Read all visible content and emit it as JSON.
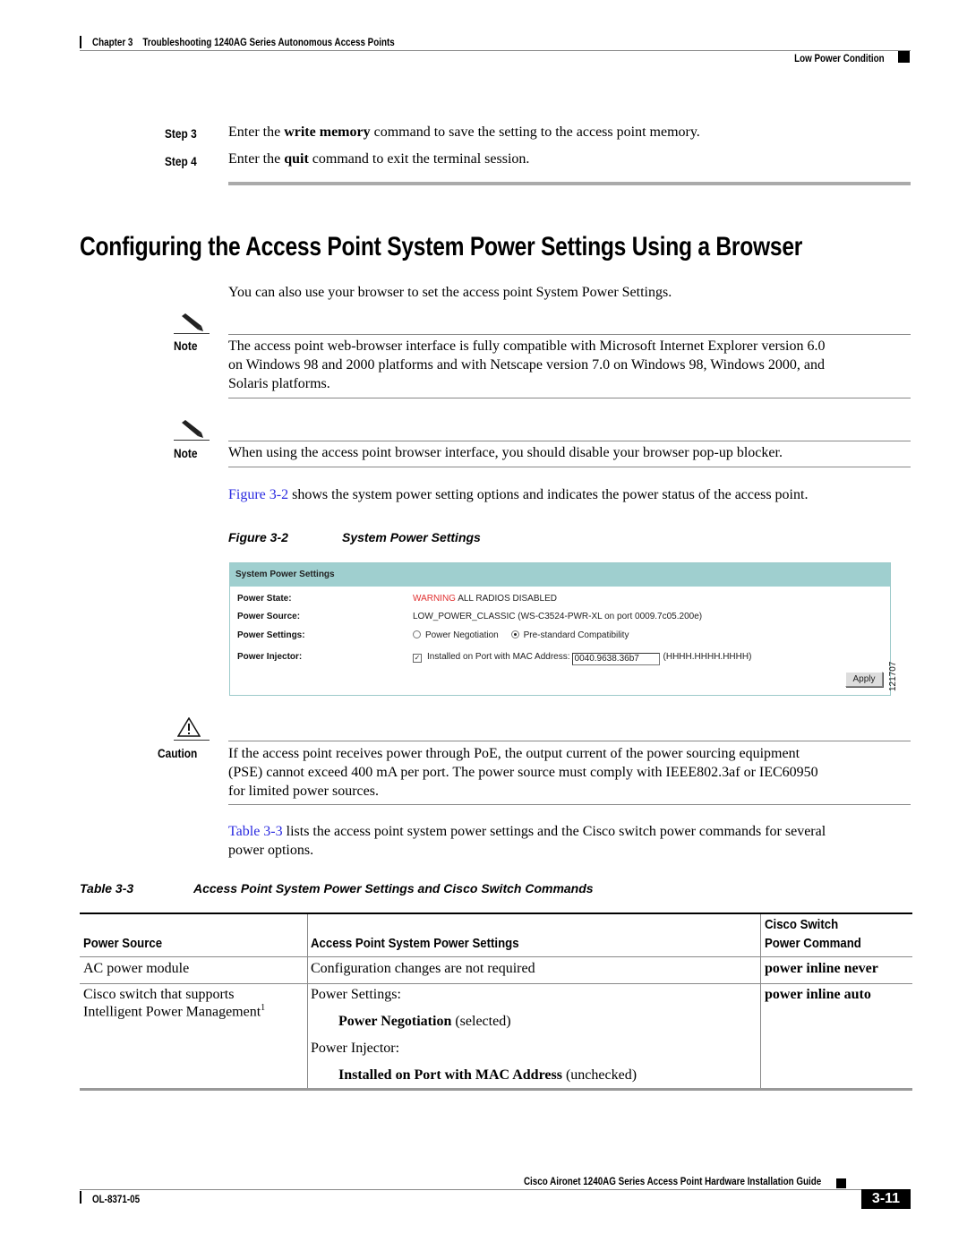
{
  "header": {
    "chapter": "Chapter 3",
    "chapter_title": "Troubleshooting 1240AG Series Autonomous Access Points",
    "section": "Low Power Condition"
  },
  "steps": [
    {
      "label": "Step 3",
      "pre": "Enter the ",
      "cmd": "write memory",
      "post": " command to save the setting to the access point memory."
    },
    {
      "label": "Step 4",
      "pre": "Enter the ",
      "cmd": "quit",
      "post": " command to exit the terminal session."
    }
  ],
  "section_heading": "Configuring the Access Point System Power Settings Using a Browser",
  "intro": "You can also use your browser to set the access point System Power Settings.",
  "notes": [
    {
      "label": "Note",
      "icon": "pencil-icon",
      "lines": [
        "The access point web-browser interface is fully compatible with Microsoft Internet Explorer version 6.0",
        "on Windows 98 and 2000 platforms and with Netscape version 7.0 on Windows 98, Windows 2000, and",
        "Solaris platforms."
      ]
    },
    {
      "label": "Note",
      "icon": "pencil-icon",
      "lines": [
        "When using the access point browser interface, you should disable your browser pop-up blocker."
      ]
    }
  ],
  "figure_ref_para": {
    "link": "Figure 3-2",
    "text": " shows the system power setting options and indicates the power status of the access point."
  },
  "figure": {
    "number": "Figure 3-2",
    "title": "System Power Settings",
    "id": "121707",
    "panel": {
      "title": "System Power Settings",
      "rows": {
        "power_state": {
          "label": "Power State:",
          "warning": "WARNING",
          "value": " ALL RADIOS DISABLED"
        },
        "power_source": {
          "label": "Power Source:",
          "value": "LOW_POWER_CLASSIC (WS-C3524-PWR-XL on port 0009.7c05.200e)"
        },
        "power_settings": {
          "label": "Power Settings:",
          "options": [
            {
              "label": "Power Negotiation",
              "selected": false
            },
            {
              "label": "Pre-standard Compatibility",
              "selected": true
            }
          ]
        },
        "power_injector": {
          "label": "Power Injector:",
          "checkbox_label": "Installed on Port with MAC Address:",
          "checked": true,
          "mac_value": "0040.9638.36b7",
          "format_hint": "(HHHH.HHHH.HHHH)"
        }
      },
      "apply_label": "Apply",
      "colors": {
        "header_bg": "#9fcfcf",
        "warning": "#e03030"
      }
    }
  },
  "caution": {
    "label": "Caution",
    "icon": "warning-triangle-icon",
    "lines": [
      "If the access point receives power through PoE, the output current of the power sourcing equipment",
      "(PSE) cannot exceed 400 mA per port. The power source must comply with IEEE802.3af or IEC60950",
      "for limited power sources."
    ]
  },
  "table_ref_para": {
    "link": "Table 3-3",
    "text_line1": " lists the access point system power settings and the Cisco switch power commands for several",
    "text_line2": "power options."
  },
  "table": {
    "number": "Table 3-3",
    "title": "Access Point System Power Settings and Cisco Switch Commands",
    "headers": [
      "Power Source",
      "Access Point System Power Settings",
      "Cisco Switch",
      "Power Command"
    ],
    "rows": [
      {
        "source": "AC power module",
        "settings": "Configuration changes are not required",
        "command": "power inline never"
      },
      {
        "source_line1": "Cisco switch that supports",
        "source_line2": "Intelligent Power Management",
        "footnote": "1",
        "settings_label1": "Power Settings:",
        "settings_value1_bold": "Power Negotiation",
        "settings_value1_note": " (selected)",
        "settings_label2": "Power Injector:",
        "settings_value2_bold": "Installed on Port with MAC Address",
        "settings_value2_note": " (unchecked)",
        "command": "power inline auto"
      }
    ]
  },
  "footer": {
    "guide_title": "Cisco Aironet 1240AG Series Access Point Hardware Installation Guide",
    "doc_number": "OL-8371-05",
    "page": "3-11"
  },
  "colors": {
    "link": "#2a2ae0"
  }
}
